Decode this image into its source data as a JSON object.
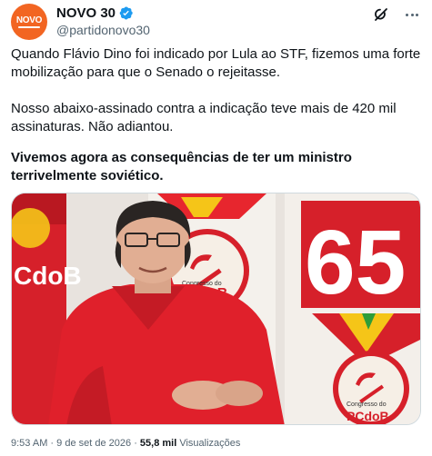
{
  "author": {
    "display_name": "NOVO 30",
    "handle": "@partidonovo30",
    "avatar_text": "NOVO",
    "avatar_color": "#f26522",
    "verified": true,
    "verified_color": "#1d9bf0"
  },
  "actions": {
    "grok_icon": "grok-icon",
    "more_icon": "more-options-icon"
  },
  "tweet": {
    "paragraph_1": "Quando Flávio Dino foi indicado por Lula ao STF, fizemos uma forte mobilização para que o Senado o rejeitasse.",
    "paragraph_2": "Nosso abaixo-assinado contra a indicação teve mais de 420 mil assinaturas. Não adiantou.",
    "paragraph_3": "Vivemos agora as consequências de ter um ministro terrivelmente soviético."
  },
  "media": {
    "banner_number": "65",
    "banner_left_text": "CdoB",
    "banner_mid_top": "Congresso do",
    "banner_mid_bottom": "PCdoB",
    "banner_bottom_top": "Congresso do",
    "banner_bottom_bottom": "PCdoB",
    "brand_red": "#d6202a",
    "brand_yellow": "#f5c518"
  },
  "meta": {
    "time": "9:53 AM",
    "separator": "·",
    "date": "9 de set de 2026",
    "views_count": "55,8 mil",
    "views_label": "Visualizações"
  }
}
